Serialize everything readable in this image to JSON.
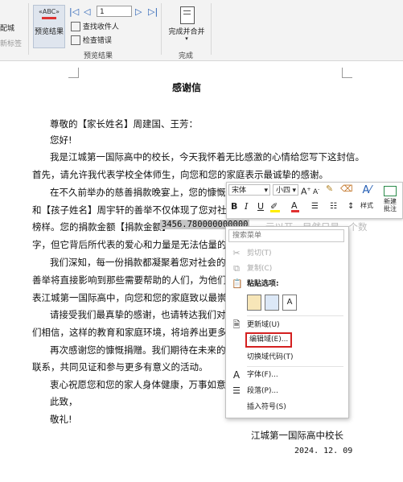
{
  "ribbon": {
    "left_partial": {
      "top": "配城",
      "bottom": "新标签"
    },
    "preview_group": {
      "abc_icon": "«ABC»",
      "preview_button": "预览结果",
      "record_number": "1",
      "find_recipient": "查找收件人",
      "check_errors": "检查错误",
      "group_label": "预览结果"
    },
    "finish_group": {
      "finish_merge": "完成并合并",
      "group_label": "完成"
    }
  },
  "document": {
    "title": "感谢信",
    "lines": [
      "尊敬的【家长姓名】周建国、王芳：",
      "您好!",
      "我是江城第一国际高中的校长，今天我怀着无比感激的心情给您写下这封信。",
      "首先，请允许我代表学校全体师生，向您和您的家庭表示最诚挚的感谢。",
      "在不久前举办的慈善捐款晚宴上，您的慷慨解",
      "和【孩子姓名】周宇轩的善举不仅体现了您对社会的",
      "榜样。您的捐款金额【捐款金额】",
      "字，但它背后所代表的爱心和力量是无法估量的。",
      "我们深知，每一份捐款都凝聚着您对社会的关",
      "善举将直接影响到那些需要帮助的人们，为他们带",
      "表江城第一国际高中，向您和您的家庭致以最崇高",
      "请接受我们最真挚的感谢，也请转达我们对",
      "们相信，这样的教育和家庭环境，将培养出更多有",
      "再次感谢您的慷慨捐赠。我们期待在未来的日",
      "联系，共同见证和参与更多有意义的活动。",
      "衷心祝愿您和您的家人身体健康，万事如意。",
      "此致，",
      "敬礼!"
    ],
    "field_value": "3456.780000000000",
    "trailing_fragment": "元以开，目然只是一个数",
    "signature": "江城第一国际高中校长",
    "date": "2024. 12. 09"
  },
  "mini_toolbar": {
    "font_name": "宋体",
    "font_size": "小四",
    "bold": "B",
    "italic": "I",
    "underline": "U",
    "styles_label": "样式",
    "new_comment_label": "新建批注"
  },
  "context_menu": {
    "search_placeholder": "搜索菜单",
    "cut": "剪切(T)",
    "copy": "复制(C)",
    "paste_options": "粘贴选项:",
    "update_field": "更新域(U)",
    "edit_field": "编辑域(E)...",
    "toggle_field_codes": "切换域代码(T)",
    "font": "字体(F)...",
    "paragraph": "段落(P)...",
    "insert_symbol": "插入符号(S)"
  },
  "colors": {
    "highlight_red": "#d42020",
    "font_color_red": "#e03030",
    "highlight_yellow": "#ffee00",
    "ribbon_bg": "#f3f3f3",
    "selection": "#c6c6c6"
  }
}
